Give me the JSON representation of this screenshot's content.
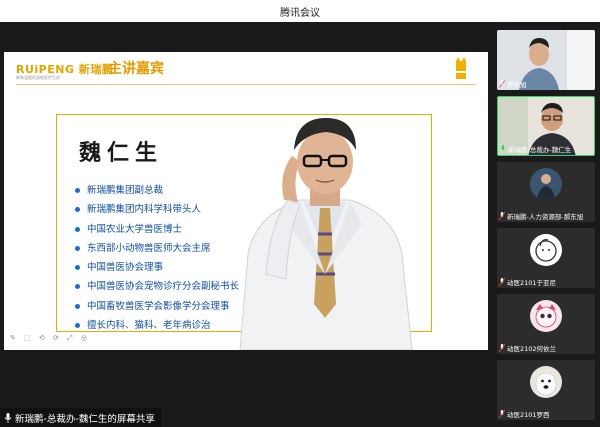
{
  "window": {
    "title": "腾讯会议"
  },
  "slide": {
    "logo": "RUiPENG 新瑞鹏",
    "logo_sub": "做有温度的宠物医疗生态",
    "heading": "主讲嘉宾",
    "speaker_name": "魏仁生",
    "bullets": [
      "新瑞鹏集团副总裁",
      "新瑞鹏集团内科学科带头人",
      "中国农业大学兽医博士",
      "东西部小动物兽医师大会主席",
      "中国兽医协会理事",
      "中国兽医协会宠物诊疗分会副秘书长",
      "中国畜牧兽医学会影像学分会理事",
      "擅长内科、猫科、老年病诊治"
    ],
    "toolbar_glyphs": "✎ ⬚ ⟲ ⟳ ⤢ ◎"
  },
  "share_banner": {
    "text": "新瑞鹏-总裁办-魏仁生的屏幕共享"
  },
  "participants": [
    {
      "label": "郝东旭",
      "type": "video"
    },
    {
      "label": "新瑞鹏-总裁办-魏仁生",
      "type": "video",
      "active": true
    },
    {
      "label": "新瑞鹏-人力资源部-郝东旭",
      "type": "avatar"
    },
    {
      "label": "动医2101于亚尼",
      "type": "avatar"
    },
    {
      "label": "动医2102何依兰",
      "type": "avatar"
    },
    {
      "label": "动医2101罗西",
      "type": "avatar"
    }
  ],
  "colors": {
    "accent": "#e59b00",
    "bullet_text": "#0f4fa0",
    "active_border": "#35d06a"
  }
}
